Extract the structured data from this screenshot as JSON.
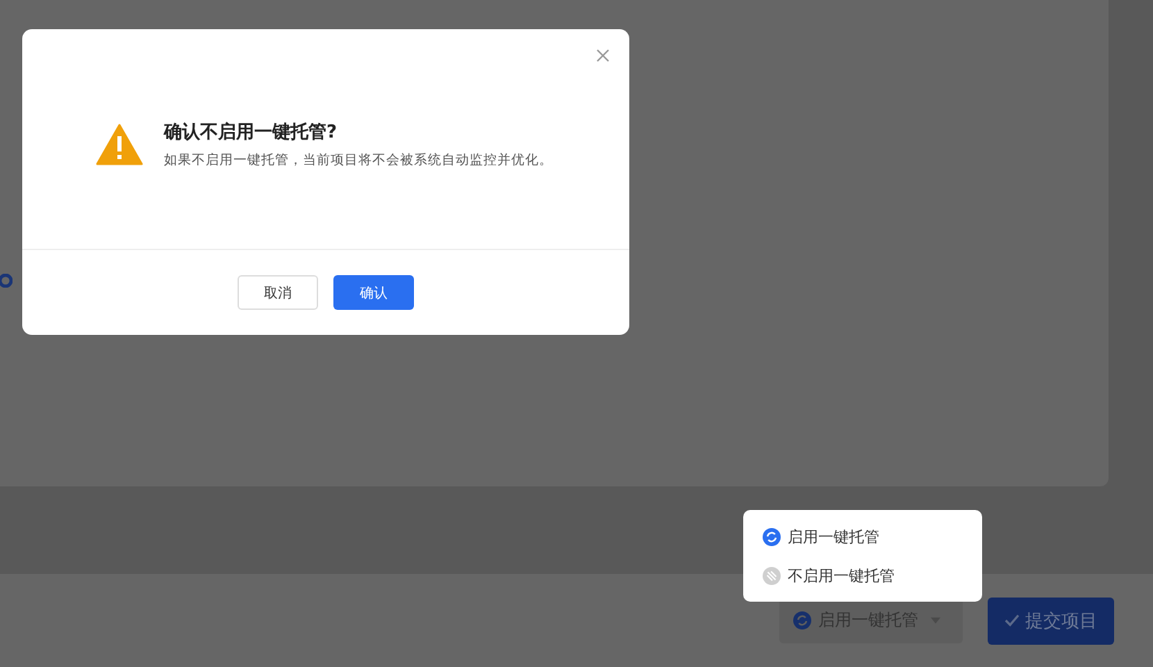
{
  "dialog": {
    "title": "确认不启用一键托管?",
    "message": "如果不启用一键托管，当前项目将不会被系统自动监控并优化。",
    "buttons": [
      {
        "label": "取消",
        "kind": "default"
      },
      {
        "label": "确认",
        "kind": "primary"
      }
    ]
  },
  "dropdown_menu": {
    "items": [
      {
        "label": "启用一键托管",
        "kind": "enable"
      },
      {
        "label": "不启用一键托管",
        "kind": "disable"
      }
    ]
  },
  "footer": {
    "hosting_button": {
      "label": "启用一键托管"
    },
    "submit_button": {
      "label": "提交项目"
    }
  }
}
